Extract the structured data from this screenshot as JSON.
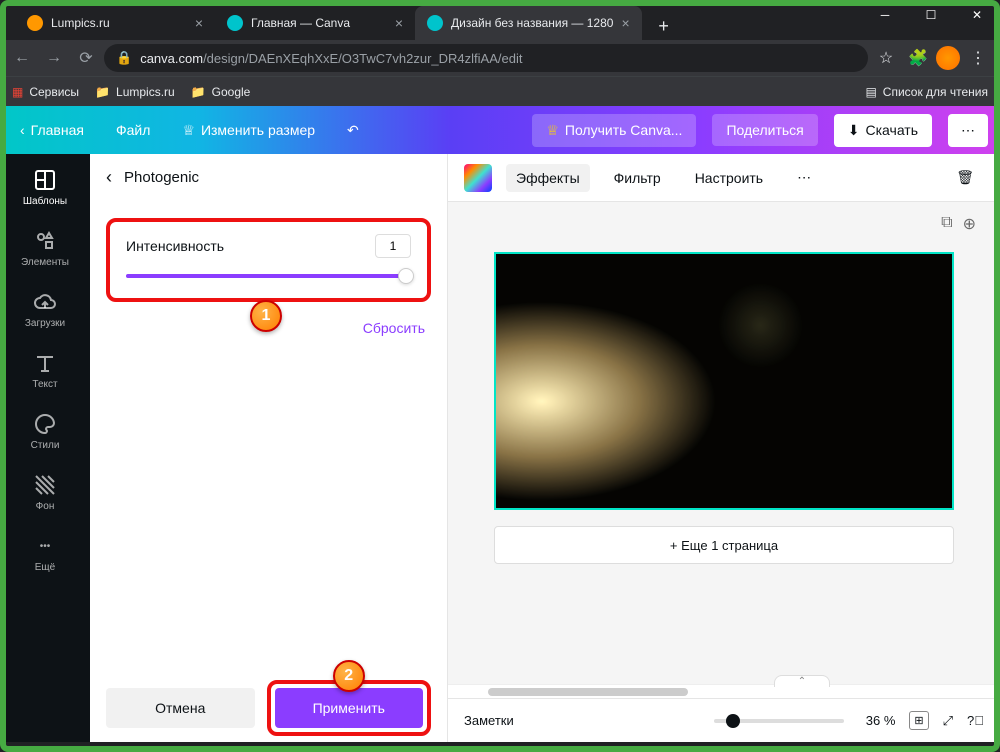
{
  "browser": {
    "tabs": [
      {
        "title": "Lumpics.ru",
        "icon_color": "#ff9800"
      },
      {
        "title": "Главная — Canva",
        "icon_color": "#00c4cc"
      },
      {
        "title": "Дизайн без названия — 1280",
        "icon_color": "#00c4cc",
        "active": true
      }
    ],
    "url_host": "canva.com",
    "url_path": "/design/DAEnXEqhXxE/O3TwC7vh2zur_DR4zlfiAA/edit",
    "bookmarks": [
      {
        "label": "Сервисы"
      },
      {
        "label": "Lumpics.ru"
      },
      {
        "label": "Google"
      }
    ],
    "reading_list": "Список для чтения"
  },
  "header": {
    "home": "Главная",
    "file": "Файл",
    "resize": "Изменить размер",
    "get_pro": "Получить Canva...",
    "share": "Поделиться",
    "download": "Скачать"
  },
  "rail": {
    "templates": "Шаблоны",
    "elements": "Элементы",
    "uploads": "Загрузки",
    "text": "Текст",
    "styles": "Стили",
    "background": "Фон",
    "more": "Ещё"
  },
  "panel": {
    "title": "Photogenic",
    "intensity_label": "Интенсивность",
    "intensity_value": "1",
    "reset": "Сбросить",
    "cancel": "Отмена",
    "apply": "Применить"
  },
  "editor_toolbar": {
    "effects": "Эффекты",
    "filter": "Фильтр",
    "adjust": "Настроить"
  },
  "editor": {
    "add_page": "+ Еще 1 страница",
    "notes": "Заметки",
    "zoom": "36 %"
  },
  "steps": {
    "one": "1",
    "two": "2"
  }
}
